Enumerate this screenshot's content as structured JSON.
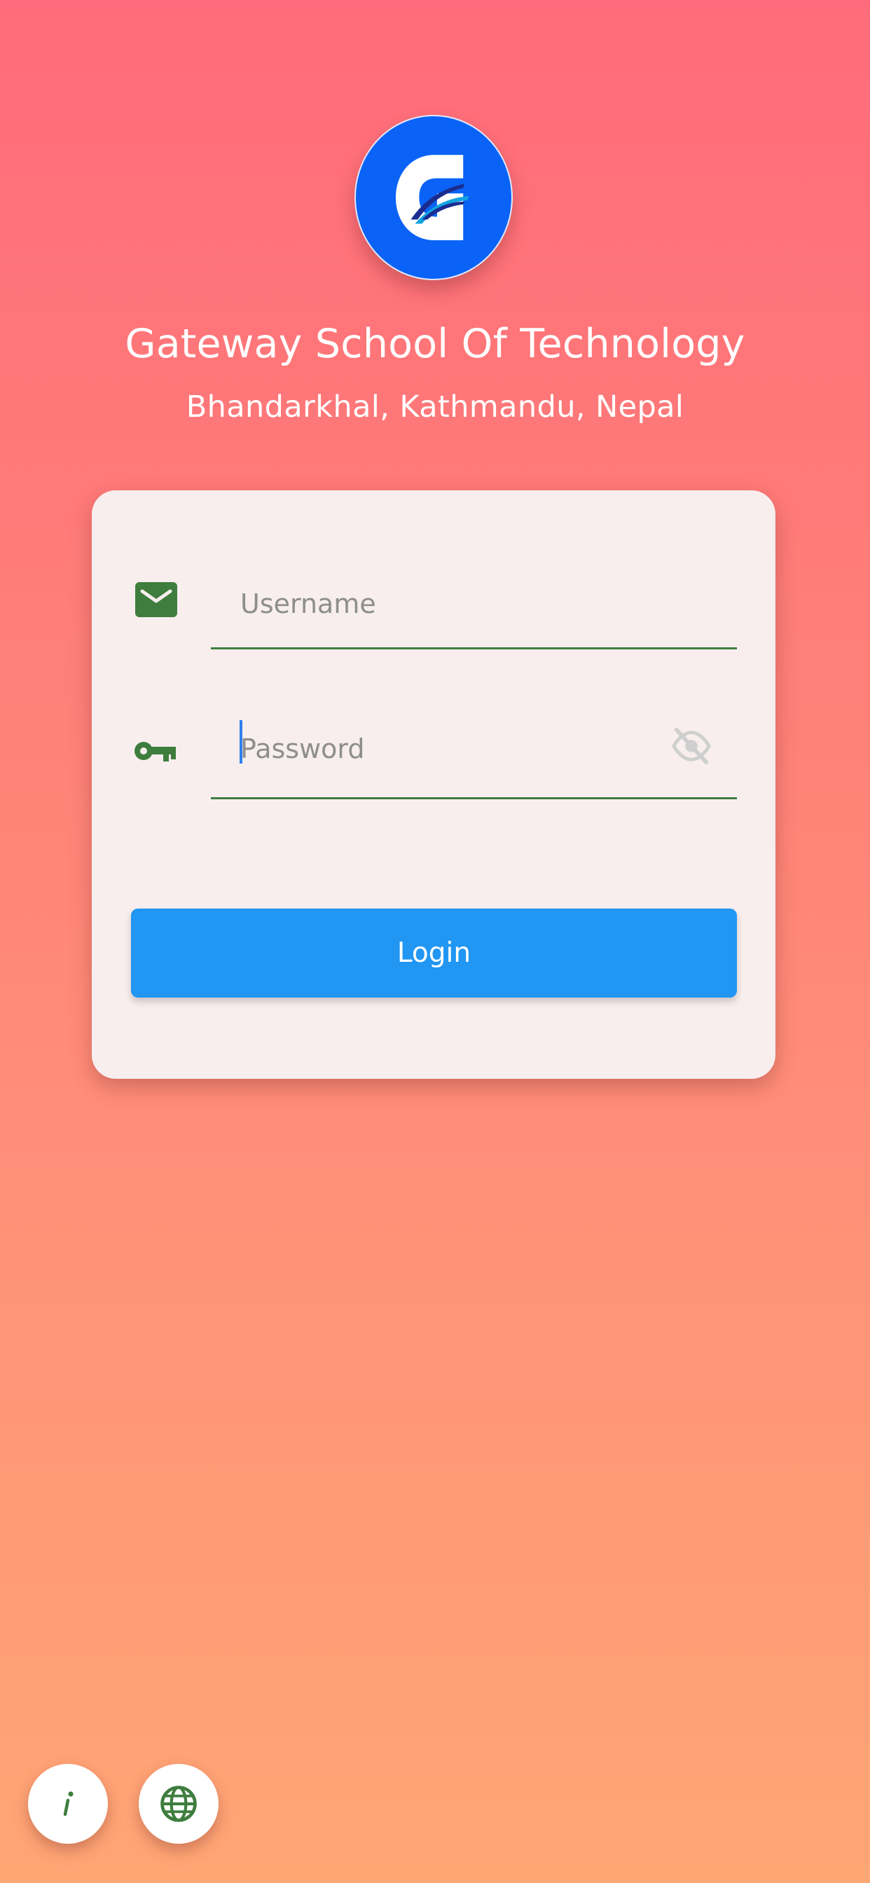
{
  "app": {
    "school_name": "Gateway School Of Technology",
    "location": "Bhandarkhal, Kathmandu, Nepal",
    "logo_icon": "gateway-g-logo"
  },
  "login_form": {
    "username": {
      "placeholder": "Username",
      "value": "",
      "icon": "envelope-icon"
    },
    "password": {
      "placeholder": "Password",
      "value": "",
      "icon": "key-icon",
      "visibility_icon": "eye-off-icon",
      "focused": true
    },
    "login_label": "Login"
  },
  "footer_buttons": {
    "info_icon": "info-icon",
    "language_icon": "globe-icon"
  },
  "colors": {
    "gradient_top": "#FF6B7A",
    "gradient_bottom": "#FFA675",
    "card_background": "#F8EEEE",
    "accent_green": "#3E7D3E",
    "login_button": "#2196F3",
    "logo_blue": "#0A63F6",
    "caret_blue": "#2F80ED"
  }
}
